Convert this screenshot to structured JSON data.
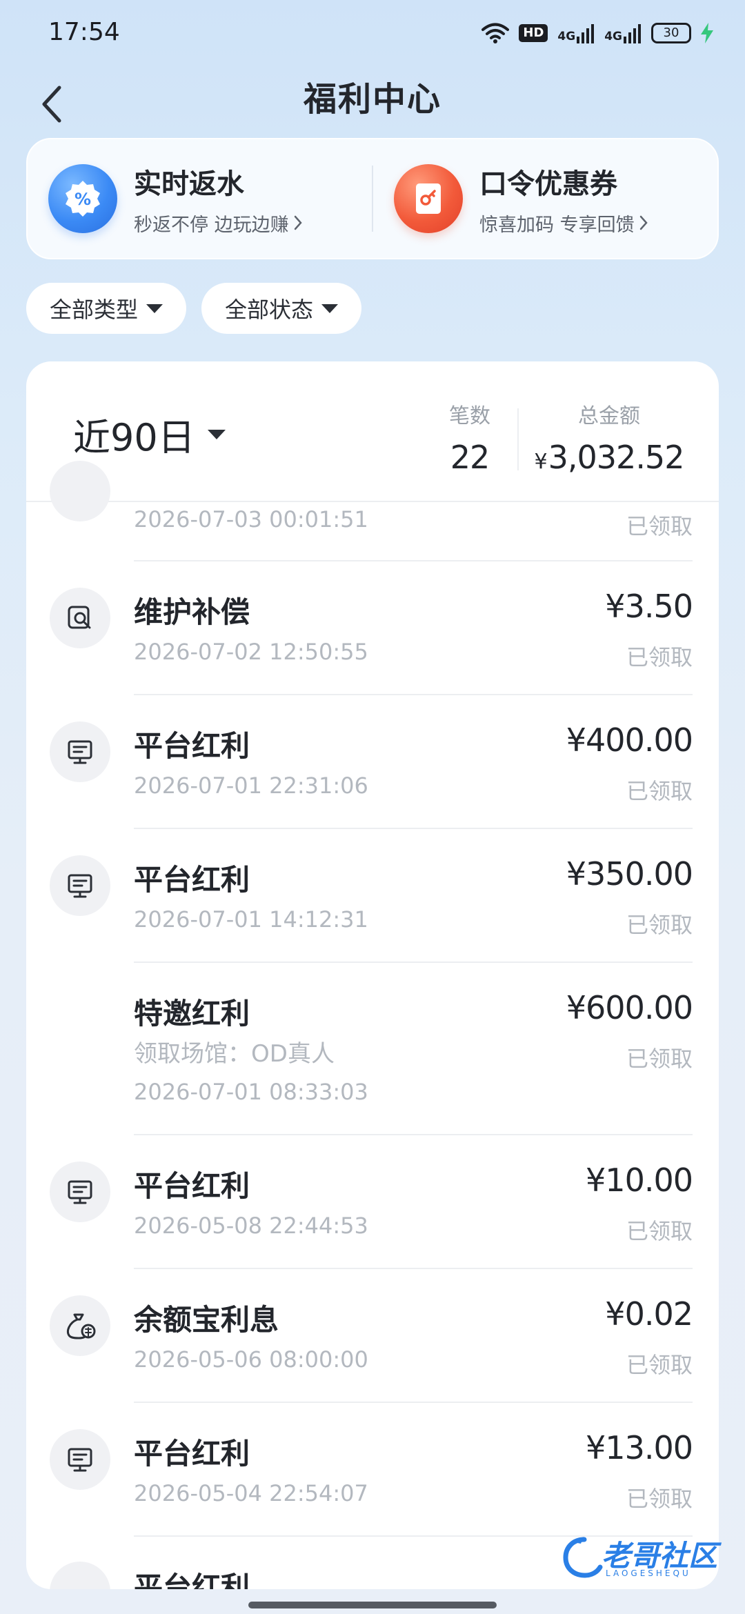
{
  "status_bar": {
    "time": "17:54",
    "wifi_icon": "wifi-icon",
    "hd_label": "HD",
    "signal_1_label": "4G",
    "signal_2_label": "4G",
    "battery_level": "30"
  },
  "header": {
    "title": "福利中心",
    "back_icon": "chevron-left-icon"
  },
  "promos": [
    {
      "title": "实时返水",
      "subtitle": "秒返不停 边玩边赚",
      "icon": "percent-badge-icon",
      "color": "#3b8af5"
    },
    {
      "title": "口令优惠券",
      "subtitle": "惊喜加码 专享回馈",
      "icon": "key-ticket-icon",
      "color": "#f25a3a"
    }
  ],
  "filters": [
    {
      "label": "全部类型"
    },
    {
      "label": "全部状态"
    }
  ],
  "summary": {
    "period": "近90日",
    "count_label": "笔数",
    "count_value": "22",
    "total_label": "总金额",
    "total_currency": "¥",
    "total_value": "3,032.52"
  },
  "records": [
    {
      "title": "",
      "subtitle": "",
      "time": "2026-07-03 00:01:51",
      "amount": "",
      "status": "已领取",
      "icon": "gift-icon",
      "partial": true
    },
    {
      "title": "维护补偿",
      "subtitle": "",
      "time": "2026-07-02 12:50:55",
      "amount": "¥3.50",
      "status": "已领取",
      "icon": "search-doc-icon"
    },
    {
      "title": "平台红利",
      "subtitle": "",
      "time": "2026-07-01 22:31:06",
      "amount": "¥400.00",
      "status": "已领取",
      "icon": "monitor-icon"
    },
    {
      "title": "平台红利",
      "subtitle": "",
      "time": "2026-07-01 14:12:31",
      "amount": "¥350.00",
      "status": "已领取",
      "icon": "monitor-icon"
    },
    {
      "title": "特邀红利",
      "subtitle": "领取场馆：OD真人",
      "time": "2026-07-01 08:33:03",
      "amount": "¥600.00",
      "status": "已领取",
      "icon": ""
    },
    {
      "title": "平台红利",
      "subtitle": "",
      "time": "2026-05-08 22:44:53",
      "amount": "¥10.00",
      "status": "已领取",
      "icon": "monitor-icon"
    },
    {
      "title": "余额宝利息",
      "subtitle": "",
      "time": "2026-05-06 08:00:00",
      "amount": "¥0.02",
      "status": "已领取",
      "icon": "money-bag-icon"
    },
    {
      "title": "平台红利",
      "subtitle": "",
      "time": "2026-05-04 22:54:07",
      "amount": "¥13.00",
      "status": "已领取",
      "icon": "monitor-icon"
    },
    {
      "title": "平台红利",
      "subtitle": "",
      "time": "",
      "amount": "",
      "status": "",
      "icon": "monitor-icon",
      "partial": true
    }
  ],
  "watermark": {
    "text": "老哥社区",
    "sub": "LAOGESHEQU"
  }
}
